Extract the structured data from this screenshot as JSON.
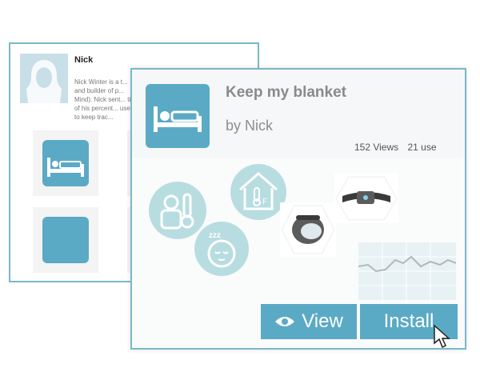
{
  "back_card": {
    "name": "Nick",
    "bio": "Nick Winter is a t... and builder of p... Mind). Nick sent... tion of his percent... uses to keep trac..."
  },
  "recipe": {
    "title": "Keep my blanket",
    "author": "by Nick",
    "views": "152 Views",
    "uses": "21 use"
  },
  "buttons": {
    "view_label": "View",
    "install_label": "Install"
  },
  "colors": {
    "accent": "#5aaac5",
    "circle": "#b8dde1",
    "border": "#7ab8c9"
  },
  "icons": {
    "main": "bed-icon",
    "triggers": [
      "person-thermometer-icon",
      "house-temperature-icon",
      "sleep-face-icon"
    ],
    "devices": [
      "wrist-tracker-device",
      "watch-band-device"
    ],
    "chart": "sparkline-chart"
  }
}
